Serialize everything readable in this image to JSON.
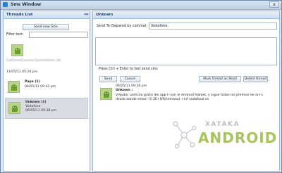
{
  "window": {
    "title": "Sms Window",
    "close_glyph": "✕"
  },
  "threads_panel": {
    "header": "Threads List",
    "collapse_glyph": "«",
    "send_new_label": "Send new Sms",
    "filter_label": "Filter text:",
    "filter_value": "",
    "threads": [
      {
        "name": "Ce/Cmm/Cunnna Gumm/ntinn (4)",
        "date": "13/05/11 05:20 pm",
        "preview": "",
        "selected": false
      },
      {
        "name": "Papa (1)",
        "date": "06/05/11 09:42 pm",
        "preview": "",
        "selected": false
      },
      {
        "name": "Unkown (1)",
        "preview": "Vodafone",
        "date": "06/05/11 09:38 pm",
        "selected": true
      }
    ]
  },
  "conversation_panel": {
    "header": "Unkown",
    "collapse_glyph": "«",
    "send_to_label": "Send To (Separed by comma):",
    "send_to_value": "Vodafone.",
    "message_value": "",
    "hint": "Press Ctrl + Enter to fast send sms",
    "send_label": "Send",
    "cancel_label": "Cancel",
    "mark_read_label": "Mark thread as Read",
    "delete_label": "Delete thread",
    "message": {
      "date": "06/05/11 09:38 pm",
      "sender": "Unkown :",
      "line1": "VPpubli: Disfruta gratis del app F-1en el Android Market, y sigue todos los premios de la F1",
      "line2": "desde donde estes! (1.3E+IVA/semana) +inf vodafone.es"
    }
  },
  "watermark": {
    "top": "XATAKA",
    "bottom": "ANDROID"
  },
  "colors": {
    "accent": "#15428b",
    "android_green": "#a7c45d"
  }
}
